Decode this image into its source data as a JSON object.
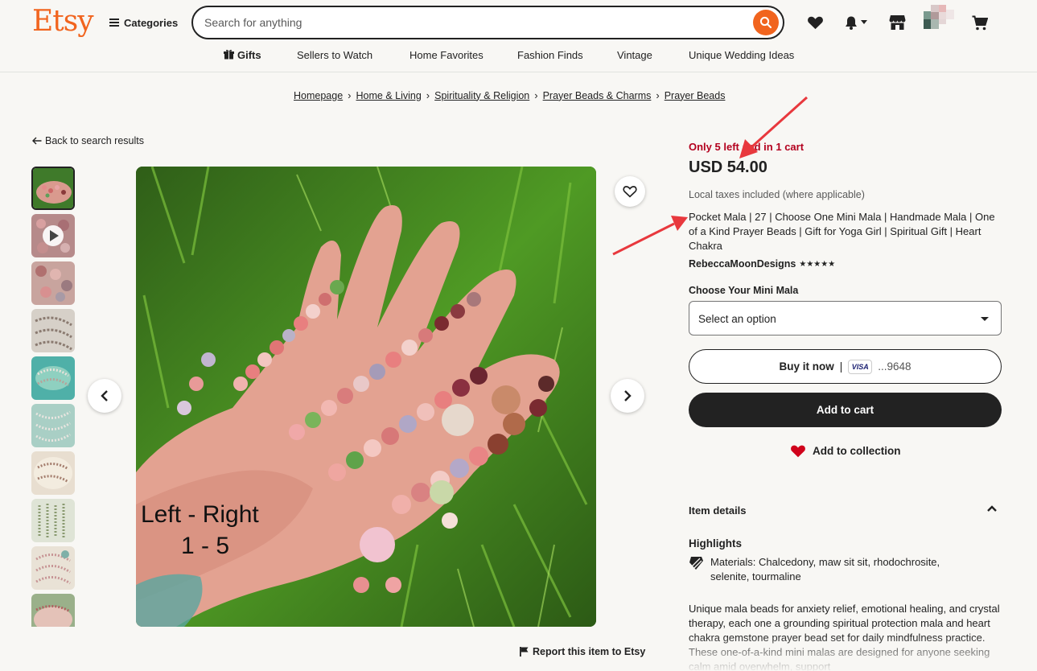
{
  "header": {
    "logo": "Etsy",
    "categories_label": "Categories",
    "search_placeholder": "Search for anything",
    "icons": [
      "heart-icon",
      "bell-icon",
      "shop-icon",
      "avatar",
      "cart-icon"
    ]
  },
  "nav": {
    "items": [
      "Gifts",
      "Sellers to Watch",
      "Home Favorites",
      "Fashion Finds",
      "Vintage",
      "Unique Wedding Ideas"
    ]
  },
  "breadcrumb": [
    "Homepage",
    "Home & Living",
    "Spirituality & Religion",
    "Prayer Beads & Charms",
    "Prayer Beads"
  ],
  "back_link": "Back to search results",
  "gallery": {
    "image_caption_line1": "Left - Right",
    "image_caption_line2": "1 - 5",
    "thumbnail_count": 10
  },
  "report": "Report this item to Etsy",
  "listing": {
    "stock_notice": "Only 5 left and in 1 cart",
    "price": "USD 54.00",
    "taxes": "Local taxes included (where applicable)",
    "title": "Pocket Mala | 27 | Choose One Mini Mala | Handmade Mala | One of a Kind Prayer Beads | Gift for Yoga Girl | Spiritual Gift | Heart Chakra",
    "shop_name": "RebeccaMoonDesigns",
    "rating_stars": "★★★★★",
    "option_label": "Choose Your Mini Mala",
    "option_value": "Select an option",
    "buy_now_label": "Buy it now",
    "card_brand": "VISA",
    "card_last4": "...9648",
    "add_to_cart": "Add to cart",
    "add_to_collection": "Add to collection"
  },
  "details": {
    "section_title": "Item details",
    "highlights_title": "Highlights",
    "materials": "Materials: Chalcedony, maw sit sit, rhodochrosite, selenite, tourmaline",
    "description": "Unique mala beads for anxiety relief, emotional healing, and crystal therapy, each one a grounding spiritual protection mala and heart chakra gemstone prayer bead set for daily mindfulness practice. These one-of-a-kind mini malas are designed for anyone seeking calm amid overwhelm, support"
  },
  "colors": {
    "brand": "#f1641e",
    "stock_red": "#b3001e",
    "dark": "#222222",
    "annotation_arrow": "#e8383d",
    "heart": "#d0021b"
  }
}
